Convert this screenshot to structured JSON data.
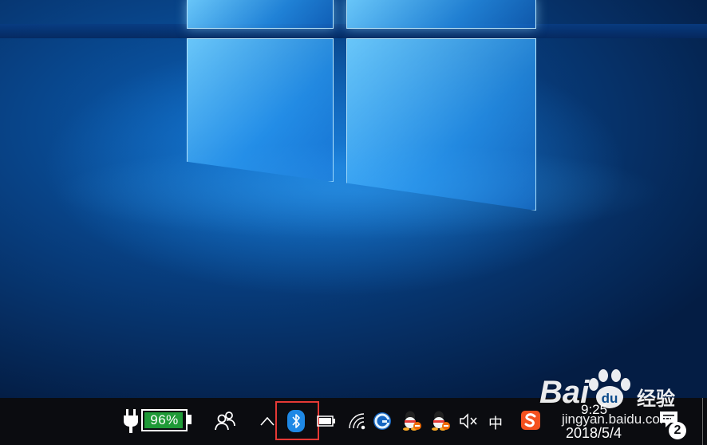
{
  "taskbar": {
    "battery": {
      "percent_label": "96%",
      "level": 0.96,
      "fill_color": "#1f9a37",
      "plug_icon": "power-plug-icon"
    },
    "people_icon": "people-icon",
    "show_hidden_icon": "chevron-up-icon",
    "tray_icons": [
      "bluetooth-icon",
      "battery-small-icon",
      "wifi-icon",
      "refresh-g-app-icon",
      "qq-penguin-icon",
      "qq-penguin-icon",
      "speaker-muted-icon"
    ],
    "ime": {
      "label": "中"
    },
    "sogou_icon": "sogou-s-icon",
    "highlight_color": "#e53935",
    "bluetooth_color": "#1e88e5",
    "clock": {
      "time": "9:25",
      "date": "2018/5/4"
    },
    "notifications": {
      "icon": "action-center-icon",
      "count": "2"
    }
  },
  "watermark": {
    "brand": "Bai",
    "brand_suffix": "经验",
    "url": "jingyan.baidu.com"
  }
}
